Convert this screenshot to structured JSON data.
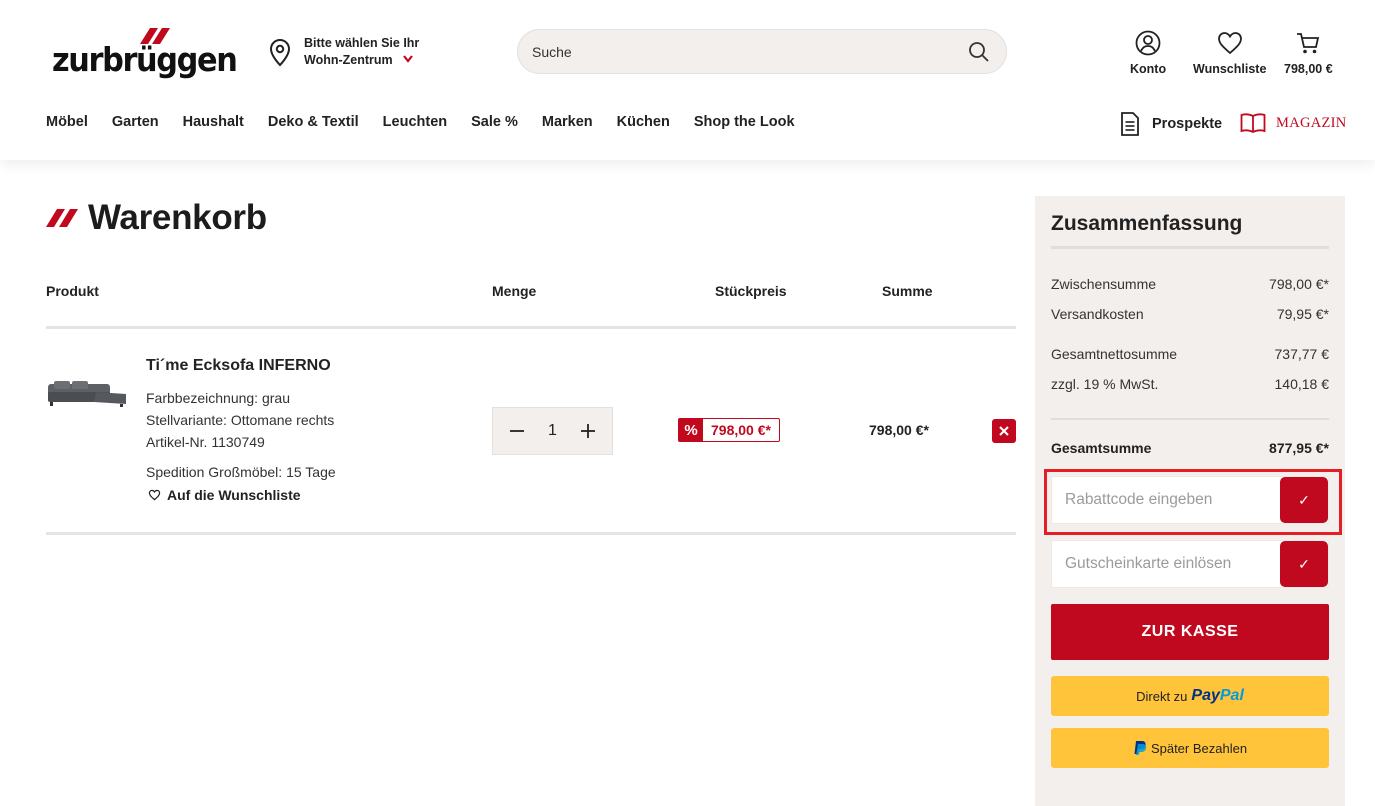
{
  "header": {
    "logo_text": "zurbrüggen",
    "location": {
      "line1": "Bitte wählen Sie Ihr",
      "line2": "Wohn-Zentrum"
    },
    "search": {
      "placeholder": "Suche"
    },
    "account_label": "Konto",
    "wishlist_label": "Wunschliste",
    "cart_total": "798,00 €"
  },
  "nav": {
    "items": [
      "Möbel",
      "Garten",
      "Haushalt",
      "Deko & Textil",
      "Leuchten",
      "Sale %",
      "Marken",
      "Küchen",
      "Shop the Look"
    ],
    "prospekte_label": "Prospekte",
    "magazin_label": "MAGAZIN"
  },
  "cart": {
    "title": "Warenkorb",
    "columns": {
      "product": "Produkt",
      "quantity": "Menge",
      "unit_price": "Stückpreis",
      "sum": "Summe"
    },
    "item": {
      "name": "Ti´me Ecksofa INFERNO",
      "color": "Farbbezeichnung: grau",
      "variant": "Stellvariante: Ottomane rechts",
      "article_no": "Artikel-Nr. 1130749",
      "delivery": "Spedition Großmöbel: 15 Tage",
      "wishlist_link": "Auf die Wunschliste",
      "quantity": "1",
      "sale_badge": "%",
      "unit_price": "798,00 €*",
      "sum": "798,00 €*"
    }
  },
  "summary": {
    "title": "Zusammenfassung",
    "rows": [
      {
        "label": "Zwischensumme",
        "value": "798,00 €*"
      },
      {
        "label": "Versandkosten",
        "value": "79,95 €*"
      },
      {
        "label": "Gesamtnettosumme",
        "value": "737,77 €"
      },
      {
        "label": "zzgl. 19 % MwSt.",
        "value": "140,18 €"
      }
    ],
    "total": {
      "label": "Gesamtsumme",
      "value": "877,95 €*"
    },
    "discount_placeholder": "Rabattcode eingeben",
    "voucher_placeholder": "Gutscheinkarte einlösen",
    "submit_glyph": "✓",
    "checkout_label": "ZUR KASSE",
    "paypal_direct": {
      "prefix": "Direkt zu",
      "brand1": "Pay",
      "brand2": "Pal"
    },
    "paypal_later": "Später Bezahlen"
  },
  "colors": {
    "brand_red": "#c0091e",
    "paypal_yellow": "#ffc439",
    "highlight_red": "#e31e24",
    "panel_bg": "#f2efed"
  }
}
